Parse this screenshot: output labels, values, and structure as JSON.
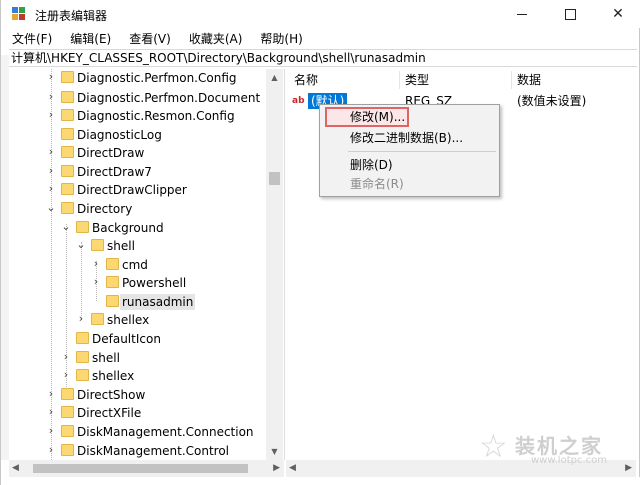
{
  "window": {
    "title": "注册表编辑器"
  },
  "menu": [
    "文件(F)",
    "编辑(E)",
    "查看(V)",
    "收藏夹(A)",
    "帮助(H)"
  ],
  "address": "计算机\\HKEY_CLASSES_ROOT\\Directory\\Background\\shell\\runasadmin",
  "tree": [
    {
      "label": "Diagnostic.Perfmon.Config"
    },
    {
      "label": "Diagnostic.Perfmon.Document"
    },
    {
      "label": "Diagnostic.Resmon.Config"
    },
    {
      "label": "DiagnosticLog"
    },
    {
      "label": "DirectDraw"
    },
    {
      "label": "DirectDraw7"
    },
    {
      "label": "DirectDrawClipper"
    },
    {
      "label": "Directory"
    },
    {
      "label": "Background"
    },
    {
      "label": "shell"
    },
    {
      "label": "cmd"
    },
    {
      "label": "Powershell"
    },
    {
      "label": "runasadmin"
    },
    {
      "label": "shellex"
    },
    {
      "label": "DefaultIcon"
    },
    {
      "label": "shell"
    },
    {
      "label": "shellex"
    },
    {
      "label": "DirectShow"
    },
    {
      "label": "DirectXFile"
    },
    {
      "label": "DiskManagement.Connection"
    },
    {
      "label": "DiskManagement.Control"
    }
  ],
  "columns": {
    "name": "名称",
    "type": "类型",
    "data": "数据"
  },
  "values": [
    {
      "icon": "ab",
      "name": "(默认)",
      "type": "REG_SZ",
      "data": "(数值未设置)"
    }
  ],
  "context_menu": {
    "modify": "修改(M)...",
    "modify_binary": "修改二进制数据(B)...",
    "delete": "删除(D)",
    "rename": "重命名(R)"
  },
  "watermark": {
    "name": "装机之家",
    "url": "www.lotpc.com"
  },
  "colors": {
    "selection": "#0078d7",
    "highlight_border": "#e06464",
    "folder": "#fbd872"
  }
}
